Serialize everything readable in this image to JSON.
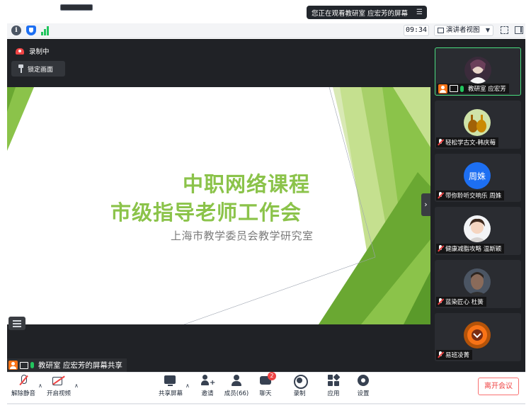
{
  "banner": {
    "viewing_text": "您正在观看教研室 应宏芳的屏幕",
    "menu_icon": "list-icon"
  },
  "toolbar": {
    "timer": "09:34",
    "view_mode": "演讲者视图"
  },
  "main": {
    "recording_label": "录制中",
    "lock_view_label": "锁定画面",
    "share_label": "教研室 应宏芳的屏幕共享"
  },
  "slide": {
    "title_line1": "中职网络课程",
    "title_line2": "市级指导老师工作会",
    "subtitle": "上海市教学委员会教学研究室",
    "accent_color": "#8bc34a"
  },
  "participants": [
    {
      "name": "教研室 应宏芳",
      "active": true
    },
    {
      "name": "轻松学古文-韩庆莓",
      "active": false
    },
    {
      "name": "带你聆听交响乐 周姝",
      "avatar_text": "周姝",
      "active": false
    },
    {
      "name": "健康减脂攻略 温斯颖",
      "active": false
    },
    {
      "name": "蓝染匠心 杜簧",
      "active": false
    },
    {
      "name": "易班凌菁",
      "active": false
    }
  ],
  "controls": {
    "unmute": "解除静音",
    "start_video": "开启视频",
    "share_screen": "共享屏幕",
    "invite": "邀请",
    "members": "成员(66)",
    "chat": "聊天",
    "chat_badge": "2",
    "record": "录制",
    "apps": "应用",
    "settings": "设置",
    "leave": "离开会议"
  }
}
